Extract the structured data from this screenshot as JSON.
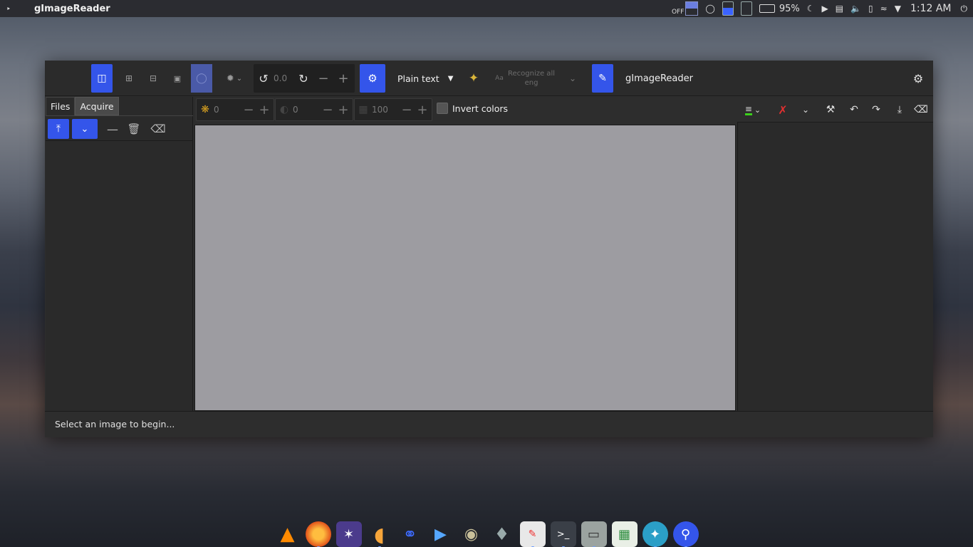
{
  "top_panel": {
    "app_menu_icon": "menu-icon",
    "active_app": "gImageReader",
    "night_light_label": "OFF",
    "battery_percent": "95%",
    "battery_level": 0.95,
    "time": "1:12 AM"
  },
  "window": {
    "title": "gImageReader",
    "rotation_value": "0.0",
    "output_mode": "Plain text",
    "recognize_label": "Recognize all",
    "recognize_lang": "eng"
  },
  "sidebar": {
    "tabs": [
      {
        "label": "Files"
      },
      {
        "label": "Acquire"
      }
    ]
  },
  "image_controls": {
    "brightness": "0",
    "contrast": "0",
    "resolution": "100",
    "invert_label": "Invert colors"
  },
  "status": {
    "message": "Select an image to begin..."
  },
  "colors": {
    "accent": "#3455ea",
    "canvas": "#9d9ca1",
    "window_bg": "#2d2d2d",
    "battery": "#3bd11a"
  },
  "dock": {
    "apps": [
      "vlc-icon",
      "firefox-icon",
      "graph-app-icon",
      "orange-slice-icon",
      "headphones-icon",
      "editor-icon",
      "gimp-icon",
      "inkscape-icon",
      "text-editor-icon",
      "terminal-icon",
      "archive-icon",
      "spreadsheet-icon",
      "color-picker-icon",
      "gimagereader-icon"
    ]
  }
}
